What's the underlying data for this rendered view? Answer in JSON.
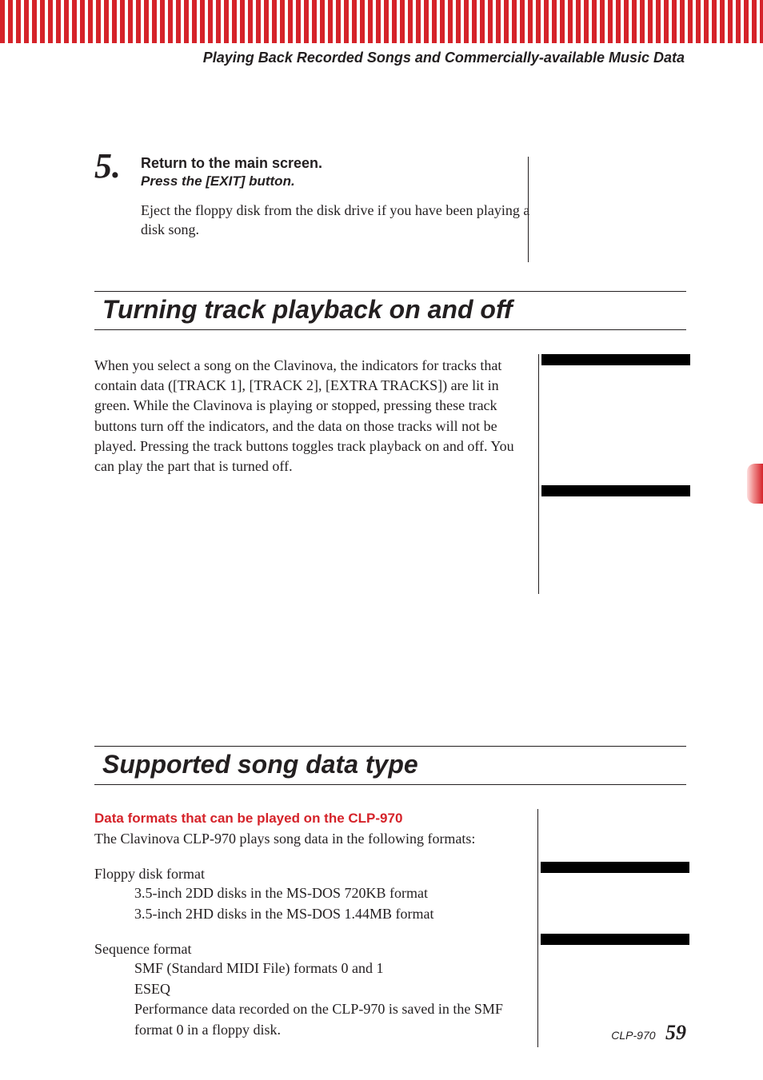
{
  "running_header": "Playing Back Recorded Songs and Commercially-available Music Data",
  "step": {
    "number": "5.",
    "title": "Return to the main screen.",
    "subtitle": "Press the [EXIT] button.",
    "paragraph": "Eject the floppy disk from the disk drive if you have been playing a disk song."
  },
  "section1": {
    "heading": "Turning track playback on and off",
    "paragraph": "When you select a song on the Clavinova, the indicators for tracks that contain data ([TRACK 1], [TRACK 2], [EXTRA TRACKS]) are lit in green. While the Clavinova is playing or stopped, pressing these track buttons turn off the indicators, and the data on those tracks will not be played. Pressing the track buttons toggles track playback on and off. You can play the part that is turned off."
  },
  "section2": {
    "heading": "Supported song data type",
    "red_subhead": "Data formats that can be played on the CLP-970",
    "intro": "The Clavinova CLP-970 plays song data in the following formats:",
    "floppy_label": "Floppy disk format",
    "floppy_line1": "3.5-inch 2DD disks in the MS-DOS 720KB format",
    "floppy_line2": "3.5-inch 2HD disks in the MS-DOS 1.44MB format",
    "seq_label": "Sequence format",
    "seq_line1": "SMF (Standard MIDI File) formats 0 and 1",
    "seq_line2": "ESEQ",
    "seq_line3": "Performance data recorded on the CLP-970 is saved in the SMF format 0 in a floppy disk."
  },
  "footer": {
    "model": "CLP-970",
    "page": "59"
  }
}
